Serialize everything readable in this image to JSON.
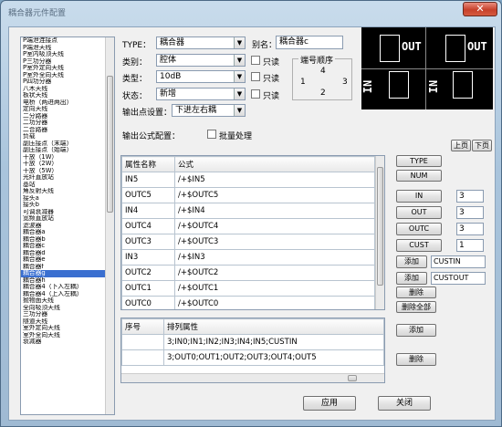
{
  "window": {
    "title": "耦合器元件配置",
    "close_label": "✕"
  },
  "sidebar": {
    "selected_index": 34,
    "items": [
      "P端泄连接点",
      "P端泄天线",
      "P室内吸顶天线",
      "P三功分器",
      "P室外定向天线",
      "P室外全向天线",
      "P四功分器",
      "八木天线",
      "板状天线",
      "电桥（两进两出）",
      "定向天线",
      "二分路器",
      "二功分器",
      "二合路器",
      "负载",
      "副压接点（末端）",
      "副压接点（始端）",
      "干放（1W）",
      "干放（2W）",
      "干放（5W）",
      "光纤直放站",
      "基站",
      "角反射天线",
      "接头a",
      "接头b",
      "可调衰减器",
      "宽频直放站",
      "滤波器",
      "耦合器a",
      "耦合器b",
      "耦合器c",
      "耦合器d",
      "耦合器e",
      "耦合器f",
      "耦合器g",
      "耦合器h",
      "耦合器4（下入左耦）",
      "耦合器4（上入左耦）",
      "抛物面天线",
      "全向吸顶天线",
      "三功分器",
      "隧道天线",
      "室外定向天线",
      "室外全向天线",
      "衰减器"
    ]
  },
  "form": {
    "type_label": "TYPE：",
    "type_value": "耦合器",
    "alias_label": "别名：",
    "alias_value": "耦合器c",
    "category_label": "类别：",
    "category_value": "腔体",
    "model_label": "类型：",
    "model_value": "10dB",
    "status_label": "状态：",
    "status_value": "新增",
    "readonly_label": "只读",
    "output_point_label": "输出点设置：",
    "output_point_value": "下进左右耦",
    "port_order_label": "端号顺序",
    "port_numbers": [
      "4",
      "1",
      "3",
      "2"
    ],
    "output_formula_label": "输出公式配置：",
    "batch_label": "批量处理"
  },
  "preview": {
    "prev_label": "上页",
    "next_label": "下页",
    "texts": [
      "OUT",
      "OUT",
      "IN",
      "IN"
    ]
  },
  "formula_table": {
    "headers": [
      "属性名称",
      "公式"
    ],
    "rows": [
      [
        "IN5",
        "/+$IN5"
      ],
      [
        "OUTC5",
        "/+$OUTC5"
      ],
      [
        "IN4",
        "/+$IN4"
      ],
      [
        "OUTC4",
        "/+$OUTC4"
      ],
      [
        "OUTC3",
        "/+$OUTC3"
      ],
      [
        "IN3",
        "/+$IN3"
      ],
      [
        "OUTC2",
        "/+$OUTC2"
      ],
      [
        "OUTC1",
        "/+$OUTC1"
      ],
      [
        "OUTC0",
        "/+$OUTC0"
      ]
    ]
  },
  "right_panel": {
    "type_btn": "TYPE",
    "num_btn": "NUM",
    "in_btn": "IN",
    "in_value": "3",
    "out_btn": "OUT",
    "out_value": "3",
    "outc_btn": "OUTC",
    "outc_value": "3",
    "cust_btn": "CUST",
    "cust_value": "1",
    "add1_btn": "添加",
    "add1_value": "CUSTIN",
    "add2_btn": "添加",
    "add2_value": "CUSTOUT",
    "delete_btn": "删除",
    "delete_all_btn": "删除全部"
  },
  "order_table": {
    "headers": [
      "序号",
      "排列属性"
    ],
    "rows": [
      [
        "",
        "3;IN0;IN1;IN2;IN3;IN4;IN5;CUSTIN"
      ],
      [
        "",
        "3;OUT0;OUT1;OUT2;OUT3;OUT4;OUT5"
      ]
    ],
    "add_btn": "添加",
    "delete_btn": "删除"
  },
  "footer": {
    "apply_btn": "应用",
    "close_btn": "关闭"
  }
}
